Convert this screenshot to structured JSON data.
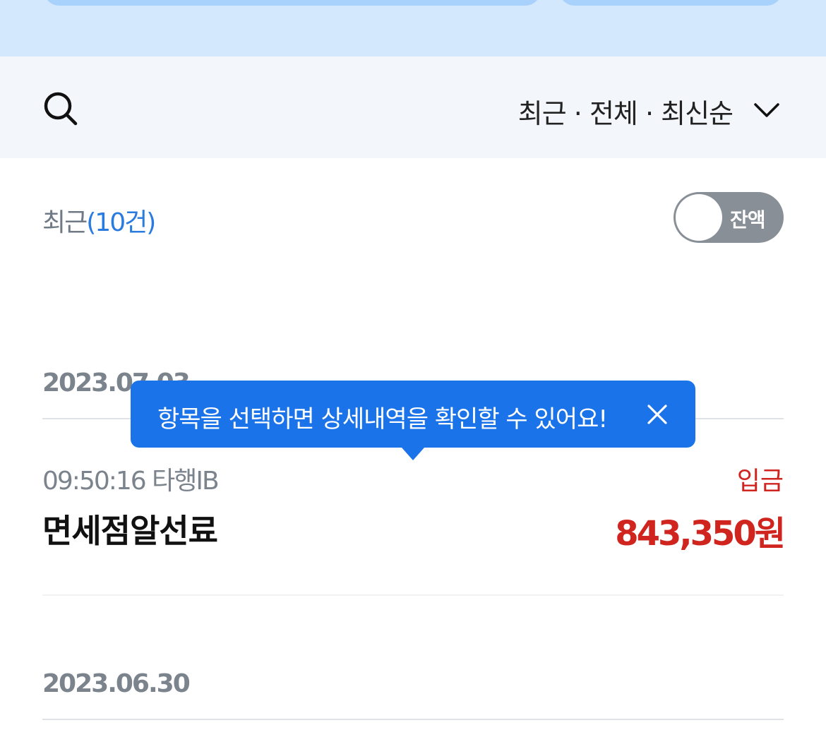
{
  "header": {
    "filter_label": "최근 · 전체 · 최신순"
  },
  "summary": {
    "label": "최근",
    "count": "(10건)",
    "balance_toggle_label": "잔액"
  },
  "groups": [
    {
      "date": "2023.07.03",
      "transactions": [
        {
          "time_and_channel": "09:50:16 타행IB",
          "type": "입금",
          "description": "면세점알선료",
          "amount": "843,350원"
        }
      ]
    },
    {
      "date": "2023.06.30"
    }
  ],
  "tooltip": {
    "text": "항목을 선택하면 상세내역을 확인할 수 있어요!"
  },
  "icons": {
    "search": "search-icon",
    "dropdown": "chevron-down-icon",
    "close": "close-icon"
  },
  "colors": {
    "accent_blue": "#1a73e8",
    "deposit_red": "#d0241f",
    "top_band": "#d3e8fd",
    "filter_bg": "#f3f6fa"
  }
}
